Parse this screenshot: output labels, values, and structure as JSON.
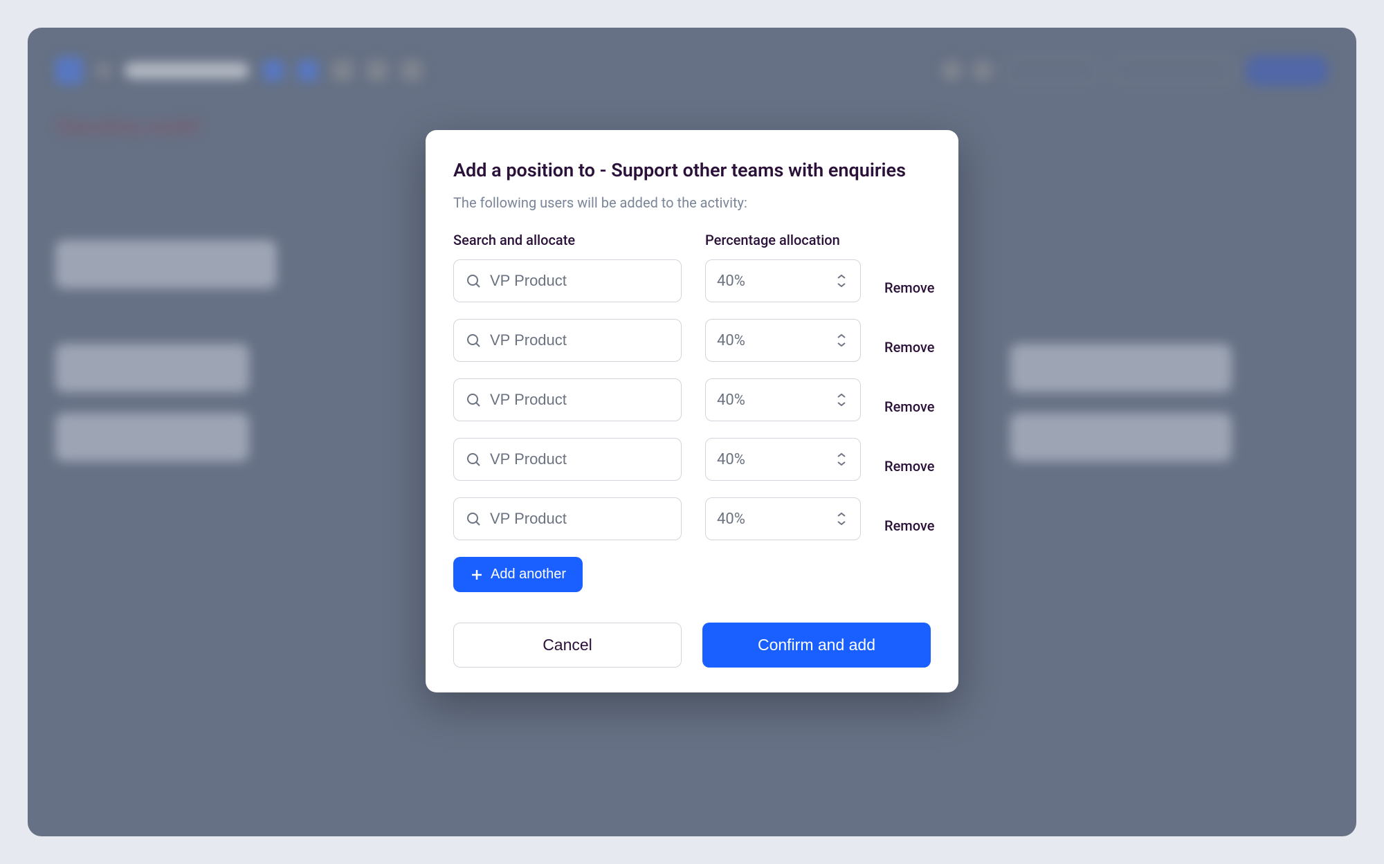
{
  "modal": {
    "title": "Add a position to - Support other teams with enquiries",
    "subtitle": "The following users will be added to the activity:",
    "columns": {
      "search": "Search and allocate",
      "percentage": "Percentage allocation"
    },
    "rows": [
      {
        "search_value": "VP Product",
        "percent": "40%",
        "remove_label": "Remove"
      },
      {
        "search_value": "VP Product",
        "percent": "40%",
        "remove_label": "Remove"
      },
      {
        "search_value": "VP Product",
        "percent": "40%",
        "remove_label": "Remove"
      },
      {
        "search_value": "VP Product",
        "percent": "40%",
        "remove_label": "Remove"
      },
      {
        "search_value": "VP Product",
        "percent": "40%",
        "remove_label": "Remove"
      }
    ],
    "add_another_label": "Add another",
    "cancel_label": "Cancel",
    "confirm_label": "Confirm and add"
  }
}
